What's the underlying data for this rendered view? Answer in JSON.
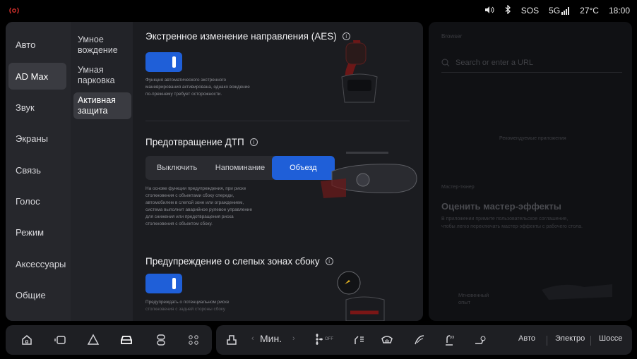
{
  "status_bar": {
    "logo": "((O))",
    "icons": [
      "volume-icon",
      "bluetooth-icon"
    ],
    "sos": "SOS",
    "network": "5G",
    "temperature": "27°C",
    "time": "18:00"
  },
  "nav_primary": [
    "Авто",
    "AD Max",
    "Звук",
    "Экраны",
    "Связь",
    "Голос",
    "Режим",
    "Аксессуары",
    "Общие"
  ],
  "nav_primary_active": "AD Max",
  "nav_secondary": [
    "Умное вождение",
    "Умная парковка",
    "Активная защита"
  ],
  "nav_secondary_active": "Активная защита",
  "aes": {
    "title": "Экстренное изменение направления (AES)",
    "toggle_on": true,
    "desc_lines": [
      "Функция автоматического экстренного",
      "маневрирования активирована, однако вождение",
      "по-прежнему требует осторожности."
    ]
  },
  "collision": {
    "title": "Предотвращение ДТП",
    "options": [
      "Выключить",
      "Напоминание",
      "Объезд"
    ],
    "selected": "Объезд",
    "desc_lines": [
      "На основе функции предупреждения, при риске",
      "столкновения с объектами сбоку спереди,",
      "автомобилем в слепой зоне или ограждением,",
      "система выполнит аварийное рулевое управление",
      "для снижения или предотвращения риска",
      "столкновения с объектом сбоку."
    ]
  },
  "blind_spot": {
    "title": "Предупреждение о слепых зонах сбоку",
    "toggle_on": true,
    "desc_lines": [
      "Предупреждать о потенциальном риске",
      "столкновения с задней стороны сбоку"
    ]
  },
  "browser": {
    "label": "Browser",
    "search_placeholder": "Search or enter a URL",
    "center_text": "Рекомендуемые приложения"
  },
  "effects": {
    "label": "Мастер-тюнер",
    "title": "Оценить мастер-эффекты",
    "desc_lines": [
      "В приложении примите пользовательское соглашение,",
      "чтобы легко переключать мастер-эффекты с рабочего стола."
    ],
    "footer_lines": [
      "Мгновенный",
      "опыт"
    ]
  },
  "dock": {
    "left_icons": [
      "home-icon",
      "car-window-icon",
      "navigation-icon",
      "car-active-icon",
      "seat-controls-icon",
      "apps-grid-icon"
    ],
    "fan_speed": "Мин.",
    "fan_off_label": "OFF",
    "modes": [
      "Авто",
      "Электро",
      "Шоссе"
    ]
  },
  "colors": {
    "accent": "#1f5fd8",
    "panel": "#1e1f23",
    "brand_red": "#e0332f"
  }
}
